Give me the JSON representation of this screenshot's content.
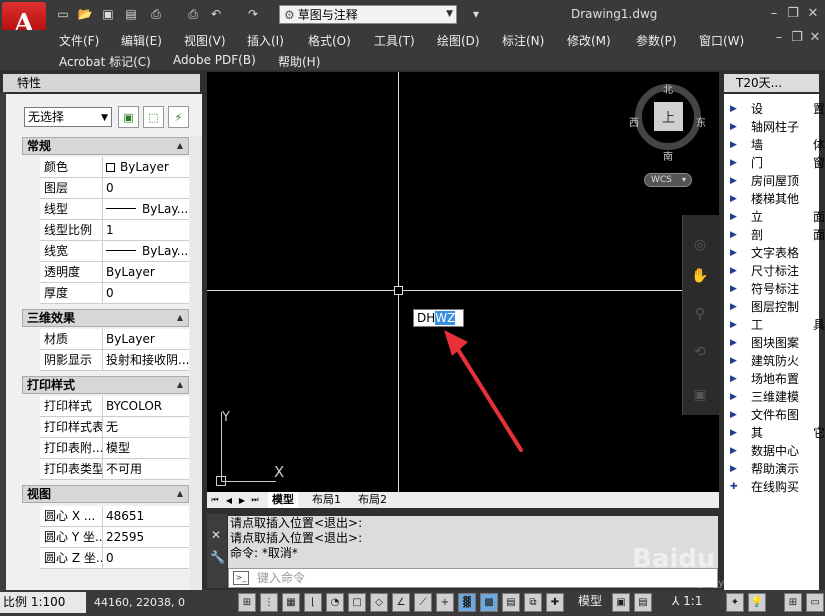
{
  "app": {
    "logo_letter": "A",
    "workspace": "草图与注释",
    "title": "Drawing1.dwg"
  },
  "menu": {
    "row1": [
      "文件(F)",
      "编辑(E)",
      "视图(V)",
      "插入(I)",
      "格式(O)",
      "工具(T)",
      "绘图(D)",
      "标注(N)",
      "修改(M)",
      "参数(P)",
      "窗口(W)"
    ],
    "row2": [
      "Acrobat 标记(C)",
      "Adobe PDF(B)",
      "帮助(H)"
    ]
  },
  "properties": {
    "title": "特性",
    "selection": "无选择",
    "sections": [
      {
        "name": "常规",
        "rows": [
          {
            "key": "颜色",
            "value": "ByLayer"
          },
          {
            "key": "图层",
            "value": "0"
          },
          {
            "key": "线型",
            "value": "ByLay..."
          },
          {
            "key": "线型比例",
            "value": "1"
          },
          {
            "key": "线宽",
            "value": "ByLay..."
          },
          {
            "key": "透明度",
            "value": "ByLayer"
          },
          {
            "key": "厚度",
            "value": "0"
          }
        ]
      },
      {
        "name": "三维效果",
        "rows": [
          {
            "key": "材质",
            "value": "ByLayer"
          },
          {
            "key": "阴影显示",
            "value": "投射和接收阴..."
          }
        ]
      },
      {
        "name": "打印样式",
        "rows": [
          {
            "key": "打印样式",
            "value": "BYCOLOR"
          },
          {
            "key": "打印样式表",
            "value": "无"
          },
          {
            "key": "打印表附...",
            "value": "模型"
          },
          {
            "key": "打印表类型",
            "value": "不可用"
          }
        ]
      },
      {
        "name": "视图",
        "rows": [
          {
            "key": "圆心 X ...",
            "value": "48651"
          },
          {
            "key": "圆心 Y 坐...",
            "value": "22595"
          },
          {
            "key": "圆心 Z 坐...",
            "value": "0"
          }
        ]
      }
    ]
  },
  "canvas": {
    "dynamic_input": {
      "plain": "DH",
      "highlight": "WZ"
    },
    "compass": {
      "north": "北",
      "south": "南",
      "east": "东",
      "west": "西",
      "center": "上"
    },
    "wcs": "WCS",
    "ucs_x": "X",
    "ucs_y": "Y"
  },
  "layout_tabs": [
    "模型",
    "布局1",
    "布局2"
  ],
  "command": {
    "history": [
      "请点取插入位置<退出>:",
      "请点取插入位置<退出>:",
      "命令: *取消*"
    ],
    "placeholder": "键入命令"
  },
  "t20": {
    "title": "T20天...",
    "items": [
      "设　置",
      "轴网柱子",
      "墙　体",
      "门　窗",
      "房间屋顶",
      "楼梯其他",
      "立　面",
      "剖　面",
      "文字表格",
      "尺寸标注",
      "符号标注",
      "图层控制",
      "工　具",
      "图块图案",
      "建筑防火",
      "场地布置",
      "三维建模",
      "文件布图",
      "其　它",
      "数据中心",
      "帮助演示",
      "在线购买"
    ]
  },
  "status": {
    "scale": "比例 1:100",
    "coords": "44160, 22038, 0",
    "model": "模型",
    "annotation_scale": "1:1"
  },
  "watermark": {
    "text": "Baidu 经验",
    "sub": "jingyan.baidu.com"
  },
  "colors": {
    "accent": "#3b8fe0",
    "arrow": "#e8303a",
    "logo": "#c00000"
  }
}
